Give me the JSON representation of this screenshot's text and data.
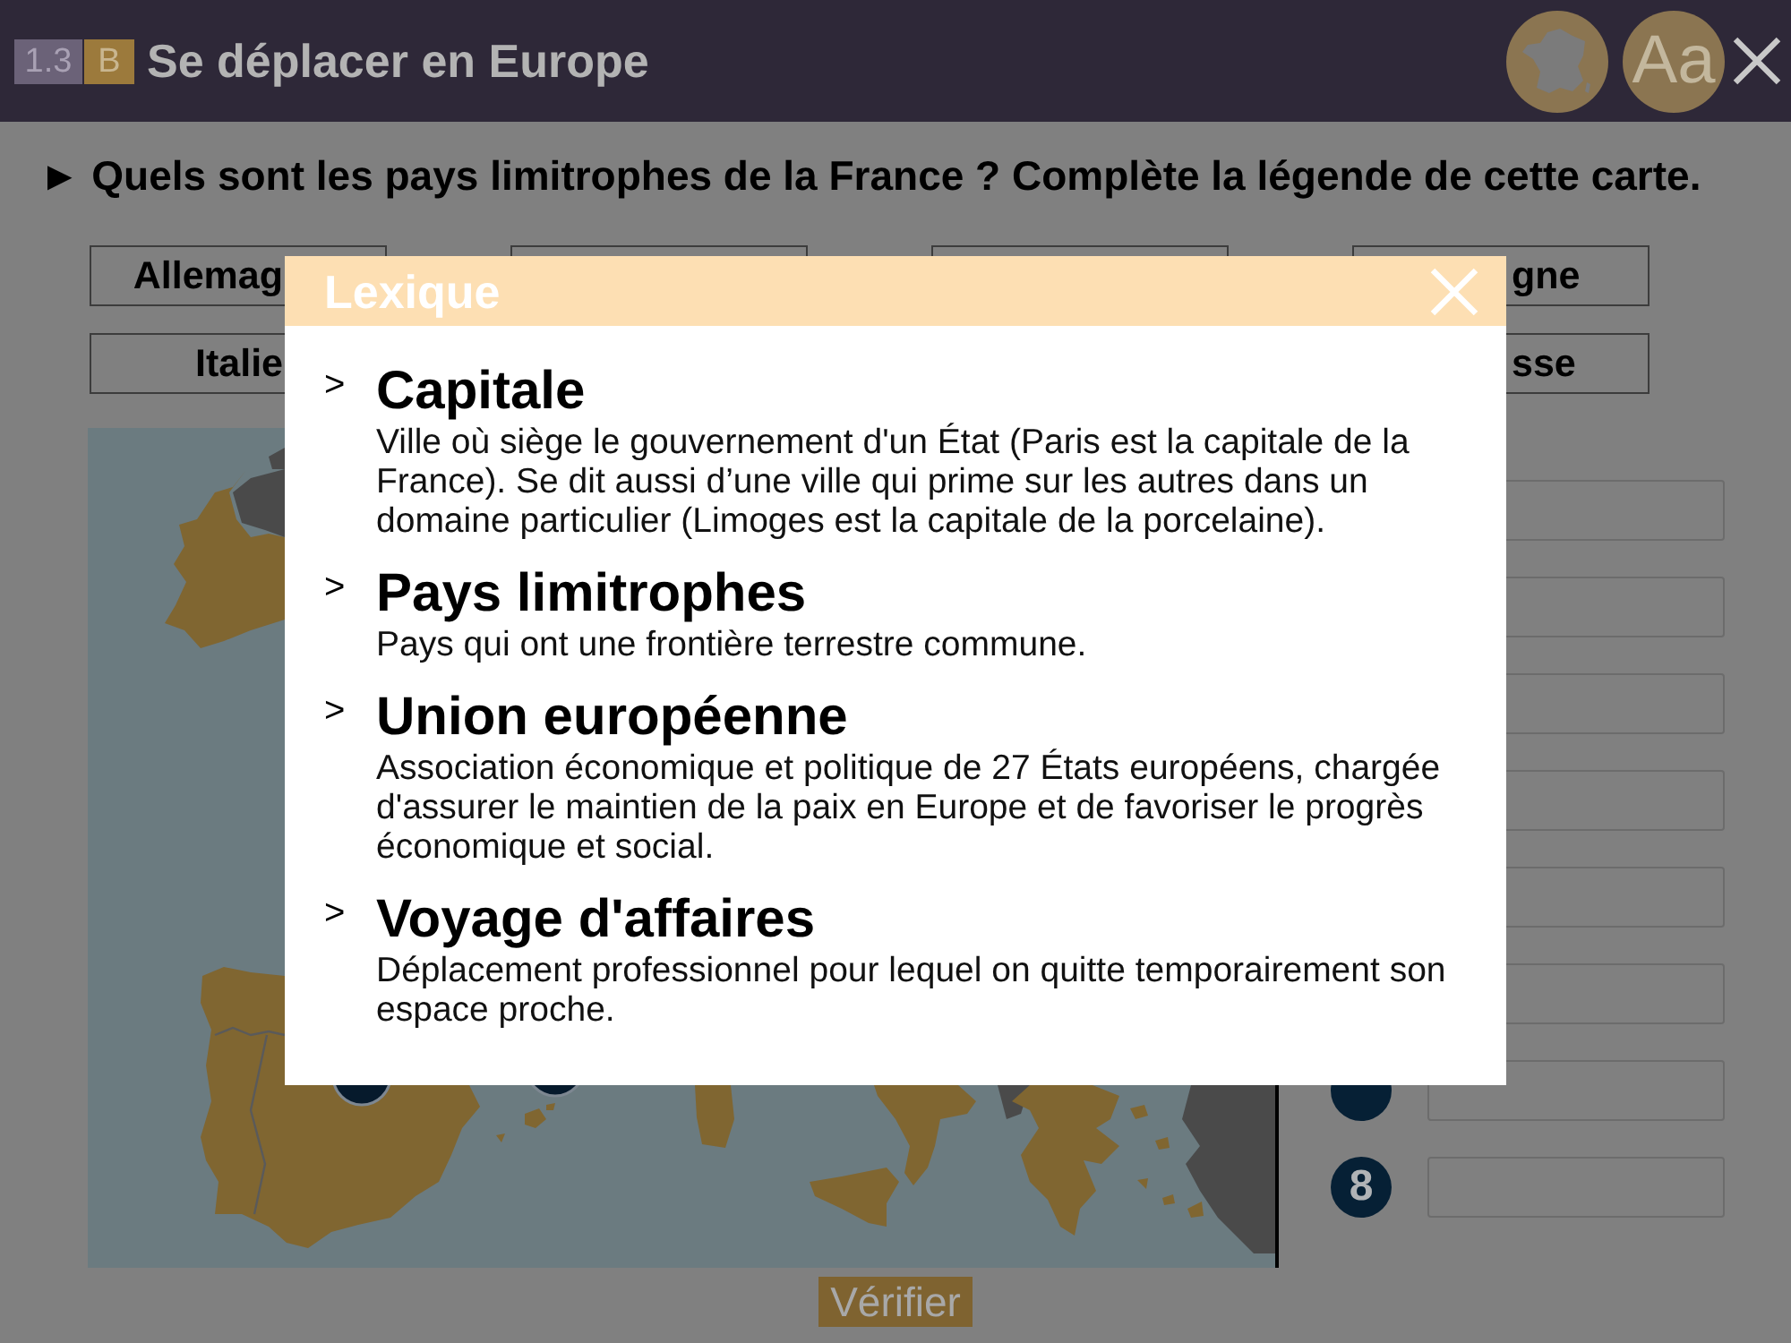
{
  "header": {
    "section_badge": "1.3",
    "level_badge": "B",
    "title": "Se déplacer en Europe",
    "font_button": "Aa"
  },
  "question": "► Quels sont les pays limitrophes de la France ? Complète la légende de cette carte.",
  "word_bank": [
    {
      "column_1": "Allemag",
      "column_4": "gne"
    },
    {
      "column_1": "Italie",
      "column_4": "sse"
    }
  ],
  "legend_rows": [
    {
      "kind": "blank"
    },
    {
      "kind": "blank"
    },
    {
      "kind": "blank"
    },
    {
      "kind": "blank"
    },
    {
      "kind": "blank"
    },
    {
      "kind": "blank"
    },
    {
      "kind": "marker"
    },
    {
      "kind": "numbered",
      "number": "8"
    }
  ],
  "verify_button": "Vérifier",
  "lexicon": {
    "title": "Lexique",
    "entries": [
      {
        "marker": ">",
        "term": "Capitale",
        "definition": "Ville où siège le gouvernement d'un État (Paris est la capitale de la France). Se dit aussi d’une ville qui prime sur les autres dans un domaine particulier (Limoges est la capitale de la porcelaine)."
      },
      {
        "marker": ">",
        "term": "Pays limitrophes",
        "definition": "Pays qui ont une frontière terrestre commune."
      },
      {
        "marker": ">",
        "term": "Union européenne",
        "definition": "Association économique et politique de 27 États européens, chargée d'assurer le maintien de la paix en Europe et de favoriser le progrès économique et social."
      },
      {
        "marker": ">",
        "term": "Voyage d'affaires",
        "definition": "Déplacement professionnel pour lequel on quitte temporairement son espace proche."
      }
    ]
  }
}
